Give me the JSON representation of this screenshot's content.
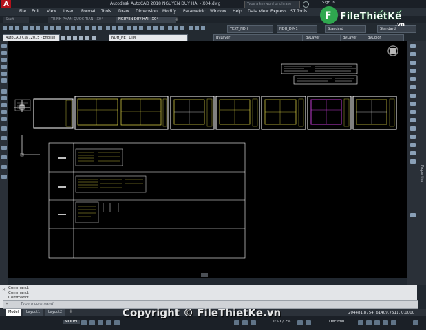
{
  "titlebar": {
    "title": "Autodesk AutoCAD 2018   NGUYEN DUY HAI - X04.dwg",
    "search_placeholder": "Type a keyword or phrase",
    "sign_in": "Sign In"
  },
  "menu": [
    "File",
    "Edit",
    "View",
    "Insert",
    "Format",
    "Tools",
    "Draw",
    "Dimension",
    "Modify",
    "Parametric",
    "Window",
    "Help",
    "Data View",
    "Express",
    "ST Tools"
  ],
  "tabs": {
    "start": "Start",
    "tab1": "TRINH PHAM QUOC TIAN - X04",
    "tab2": "NGUYEN DUY HAI - X04"
  },
  "toolbar1": {
    "text_style": "TEXT_NDH",
    "dim_style": "NDH_DIM1",
    "table_style": "Standard",
    "mleader_style": "Standard"
  },
  "toolbar2": {
    "workspace": "AutoCAD Cla...2015 - English",
    "layer": "NDH_NET DIM",
    "color": "ByLayer",
    "linetype": "ByLayer",
    "lineweight": "ByLayer",
    "plotstyle": "ByColor"
  },
  "right_panel": {
    "label": "Properties"
  },
  "command": {
    "history": [
      "Command:",
      "Command:",
      "Command:"
    ],
    "placeholder": "Type a command"
  },
  "layout_tabs": [
    "Model",
    "Layout1",
    "Layout2"
  ],
  "status": {
    "coords": "204481.8754, 61409.7511, 0.0000",
    "mode": "MODEL",
    "scale": "1:50 / 2%",
    "units": "Decimal"
  },
  "watermark": {
    "logo_text": "FileThiếtKế",
    "logo_suffix": ".vn",
    "copyright": "Copyright © FileThietKe.vn"
  },
  "colors": {
    "canvas": "#000000",
    "sheet_border": "#ffffff",
    "drawing_yellow": "#e8e04a",
    "drawing_magenta": "#c03cd0",
    "brand_green": "#2fa84f"
  }
}
